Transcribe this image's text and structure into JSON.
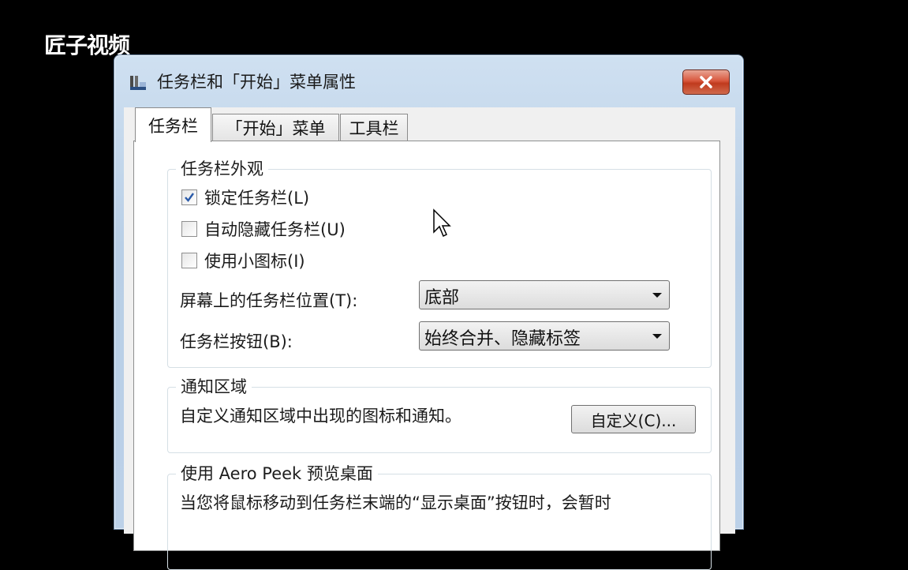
{
  "watermark": "匠子视频",
  "window": {
    "title": "任务栏和「开始」菜单属性"
  },
  "tabs": [
    {
      "label": "任务栏"
    },
    {
      "label": "「开始」菜单"
    },
    {
      "label": "工具栏"
    }
  ],
  "appearance": {
    "title": "任务栏外观",
    "lock_taskbar": {
      "label": "锁定任务栏(L)",
      "checked": true
    },
    "auto_hide": {
      "label": "自动隐藏任务栏(U)",
      "checked": false
    },
    "small_icons": {
      "label": "使用小图标(I)",
      "checked": false
    },
    "location_label": "屏幕上的任务栏位置(T):",
    "location_value": "底部",
    "buttons_label": "任务栏按钮(B):",
    "buttons_value": "始终合并、隐藏标签"
  },
  "notification": {
    "title": "通知区域",
    "description": "自定义通知区域中出现的图标和通知。",
    "customize_label": "自定义(C)..."
  },
  "aero_peek": {
    "title": "使用 Aero Peek 预览桌面",
    "description": "当您将鼠标移动到任务栏末端的“显示桌面”按钮时，会暂时"
  },
  "colors": {
    "accent_blue": "#2a5aa8",
    "close_red": "#c03a1d"
  }
}
